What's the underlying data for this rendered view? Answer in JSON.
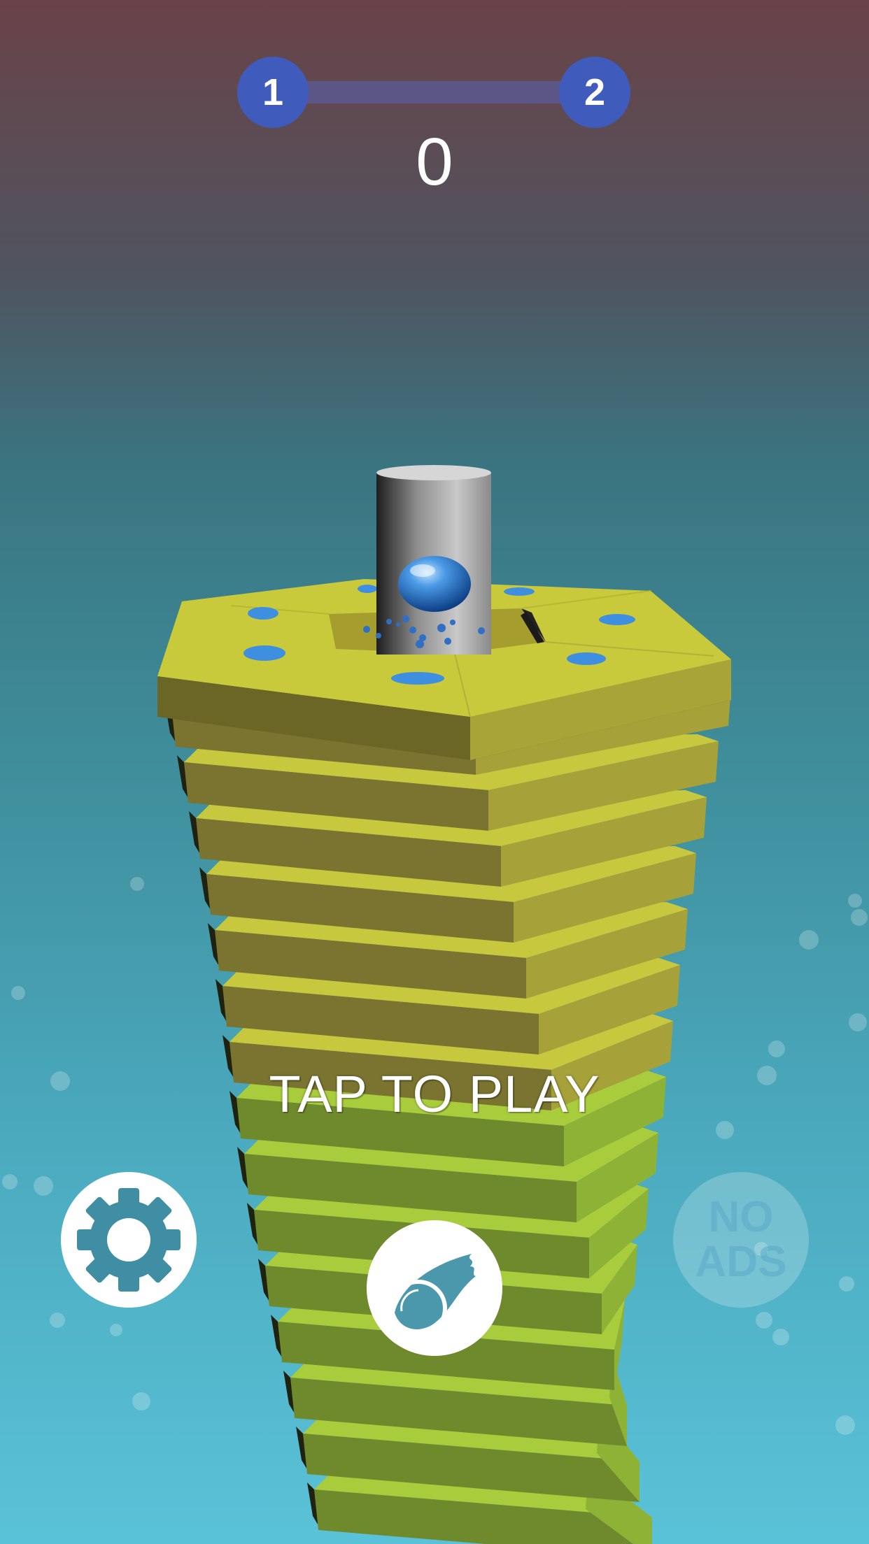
{
  "hud": {
    "current_level": "1",
    "next_level": "2",
    "score": "0"
  },
  "prompt": "TAP TO PLAY",
  "buttons": {
    "settings_icon": "gear-icon",
    "skin_icon": "ball-skin-icon",
    "no_ads_line1": "NO",
    "no_ads_line2": "ADS"
  },
  "colors": {
    "platform": "#c8c83a",
    "ball": "#3a86d8",
    "badge": "#3f5bbb",
    "progress_track": "#5b5685"
  }
}
